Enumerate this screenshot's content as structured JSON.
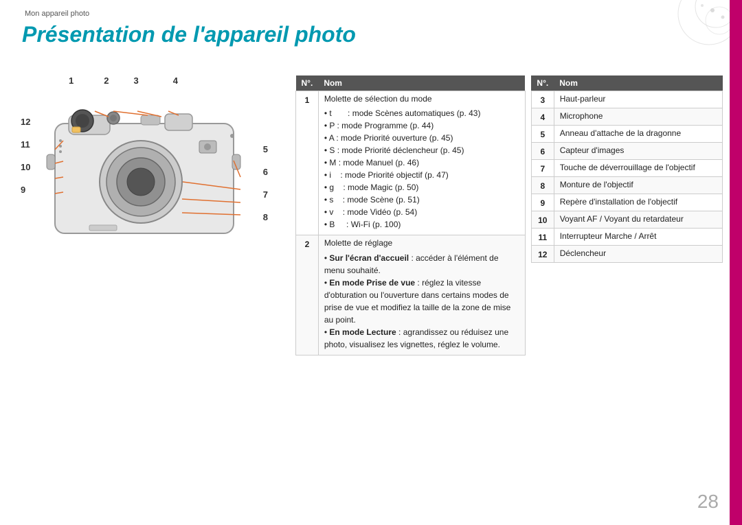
{
  "breadcrumb": "Mon appareil photo",
  "page_title": "Présentation de l'appareil photo",
  "page_number": "28",
  "left_table": {
    "headers": [
      "N°.",
      "Nom"
    ],
    "rows": [
      {
        "num": "1",
        "content_type": "list",
        "title": "Molette de sélection du mode",
        "bullets": [
          "t       : mode Scènes automatiques (p. 43)",
          "P : mode Programme (p. 44)",
          "A : mode Priorité ouverture (p. 45)",
          "S : mode Priorité déclencheur (p. 45)",
          "M : mode Manuel (p. 46)",
          "i    : mode Priorité objectif (p. 47)",
          "g    : mode Magic (p. 50)",
          "s    : mode Scène (p. 51)",
          "v    : mode Vidéo (p. 54)",
          "B     : Wi-Fi (p. 100)"
        ]
      },
      {
        "num": "2",
        "content_type": "mixed",
        "title": "Molette de réglage",
        "mixed": [
          {
            "bold": "Sur l'écran d'accueil",
            "rest": " : accéder à l'élément de menu souhaité."
          },
          {
            "bold": "En mode Prise de vue",
            "rest": " : réglez la vitesse d'obturation ou l'ouverture dans certains modes de prise de vue et modifiez la taille de la zone de mise au point."
          },
          {
            "bold": "En mode Lecture",
            "rest": " : agrandissez ou réduisez une photo, visualisez les vignettes, réglez le volume."
          }
        ]
      }
    ]
  },
  "right_table": {
    "headers": [
      "N°.",
      "Nom"
    ],
    "rows": [
      {
        "num": "3",
        "name": "Haut-parleur"
      },
      {
        "num": "4",
        "name": "Microphone"
      },
      {
        "num": "5",
        "name": "Anneau d'attache de la dragonne"
      },
      {
        "num": "6",
        "name": "Capteur d'images"
      },
      {
        "num": "7",
        "name": "Touche de déverrouillage de l'objectif"
      },
      {
        "num": "8",
        "name": "Monture de l'objectif"
      },
      {
        "num": "9",
        "name": "Repère d'installation de l'objectif"
      },
      {
        "num": "10",
        "name": "Voyant AF / Voyant du retardateur"
      },
      {
        "num": "11",
        "name": "Interrupteur Marche / Arrêt"
      },
      {
        "num": "12",
        "name": "Déclencheur"
      }
    ]
  },
  "diagram_labels": [
    "1",
    "2",
    "3",
    "4",
    "5",
    "6",
    "7",
    "8",
    "9",
    "10",
    "11",
    "12"
  ]
}
